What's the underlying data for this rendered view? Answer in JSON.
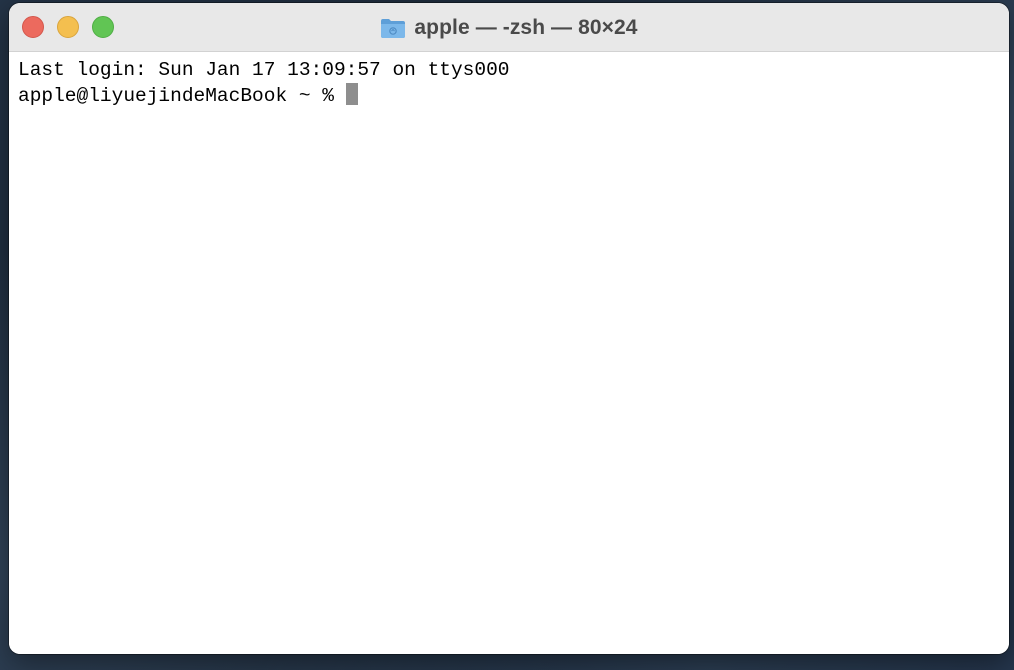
{
  "window": {
    "title": "apple — -zsh — 80×24",
    "title_icon": "folder-icon"
  },
  "terminal": {
    "lines": [
      "Last login: Sun Jan 17 13:09:57 on ttys000",
      "apple@liyuejindeMacBook ~ % "
    ]
  },
  "colors": {
    "close": "#ec6a5e",
    "minimize": "#f4bf4f",
    "zoom": "#61c554",
    "folder": "#6aa9e0",
    "cursor": "#8e8e8e"
  }
}
